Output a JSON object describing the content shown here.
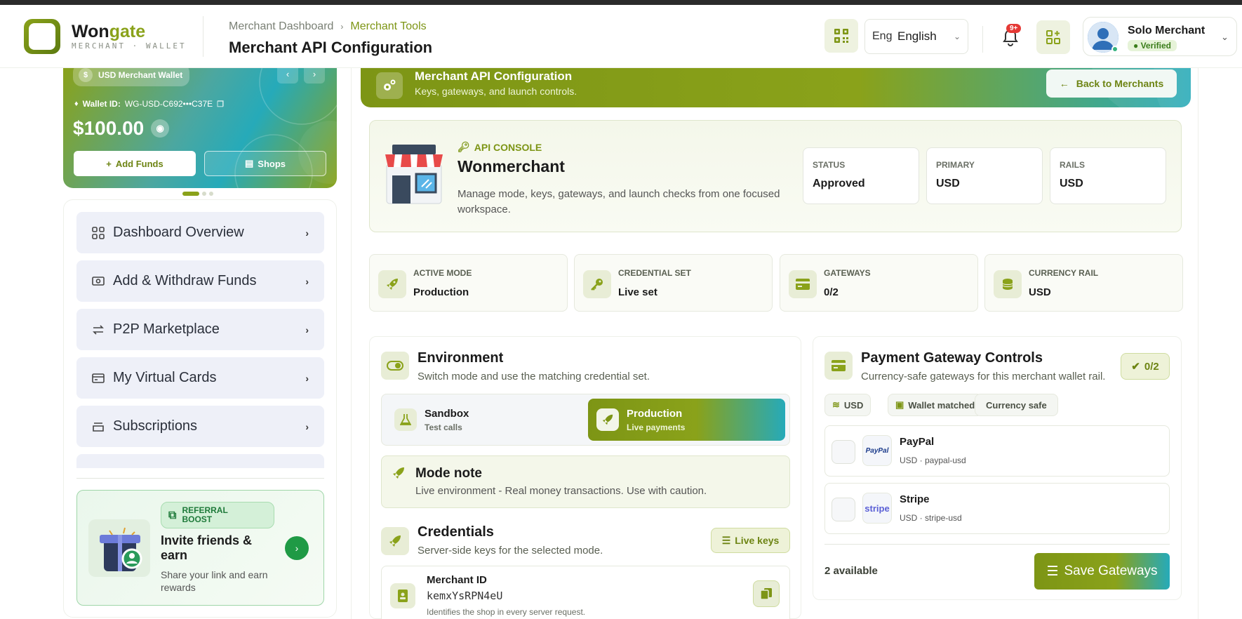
{
  "header": {
    "brand_main": "Won",
    "brand_accent": "gate",
    "brand_sub": "MERCHANT · WALLET",
    "breadcrumb": [
      "Merchant Dashboard",
      "Merchant Tools"
    ],
    "page_title": "Merchant API Configuration",
    "lang_flag": "Eng",
    "lang_label": "English",
    "notif_badge": "9+",
    "user_name": "Solo Merchant",
    "user_status": "Verified"
  },
  "wallet": {
    "pill_label": "USD Merchant Wallet",
    "pill_symbol": "$",
    "wallet_id_label": "Wallet ID:",
    "wallet_id": "WG-USD-C692•••C37E",
    "balance": "$100.00",
    "add_funds": "Add Funds",
    "shops": "Shops"
  },
  "sidebar": {
    "items": [
      {
        "label": "Dashboard Overview"
      },
      {
        "label": "Add & Withdraw Funds"
      },
      {
        "label": "P2P Marketplace"
      },
      {
        "label": "My Virtual Cards"
      },
      {
        "label": "Subscriptions"
      }
    ],
    "referral": {
      "tag": "REFERRAL BOOST",
      "title": "Invite friends & earn",
      "subtitle": "Share your link and earn rewards"
    }
  },
  "hero": {
    "title": "Merchant API Configuration",
    "subtitle": "Keys, gateways, and launch controls.",
    "back": "Back to Merchants"
  },
  "console": {
    "kicker": "API CONSOLE",
    "name": "Wonmerchant",
    "description": "Manage mode, keys, gateways, and launch checks from one focused workspace.",
    "stats": [
      {
        "label": "STATUS",
        "value": "Approved"
      },
      {
        "label": "PRIMARY",
        "value": "USD"
      },
      {
        "label": "RAILS",
        "value": "USD"
      }
    ]
  },
  "metrics": [
    {
      "label": "ACTIVE MODE",
      "value": "Production",
      "icon": "rocket-icon"
    },
    {
      "label": "CREDENTIAL SET",
      "value": "Live set",
      "icon": "key-icon"
    },
    {
      "label": "GATEWAYS",
      "value": "0/2",
      "icon": "card-icon"
    },
    {
      "label": "CURRENCY RAIL",
      "value": "USD",
      "icon": "coins-icon"
    }
  ],
  "environment": {
    "title": "Environment",
    "subtitle": "Switch mode and use the matching credential set.",
    "modes": [
      {
        "title": "Sandbox",
        "sub": "Test calls"
      },
      {
        "title": "Production",
        "sub": "Live payments"
      }
    ],
    "note_title": "Mode note",
    "note_text": "Live environment - Real money transactions. Use with caution."
  },
  "credentials": {
    "title": "Credentials",
    "subtitle": "Server-side keys for the selected mode.",
    "badge": "Live keys",
    "merchant_id_label": "Merchant ID",
    "merchant_id_value": "kemxYsRPN4eU",
    "merchant_id_hint": "Identifies the shop in every server request."
  },
  "gateways": {
    "title": "Payment Gateway Controls",
    "subtitle": "Currency-safe gateways for this merchant wallet rail.",
    "count": "0/2",
    "chips": [
      "USD",
      "Wallet matched",
      "Currency safe"
    ],
    "rows": [
      {
        "name": "PayPal",
        "meta": "USD · paypal-usd",
        "logo": "PayPal"
      },
      {
        "name": "Stripe",
        "meta": "USD · stripe-usd",
        "logo": "stripe"
      }
    ],
    "available": "2 available",
    "save": "Save Gateways"
  },
  "colors": {
    "accent": "#8aa21a",
    "teal": "#26aab9",
    "danger": "#e53935"
  }
}
